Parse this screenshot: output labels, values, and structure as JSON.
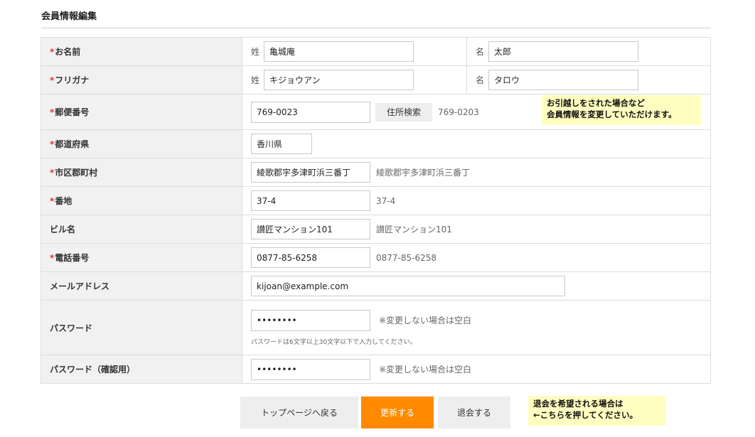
{
  "page_title": "会員情報編集",
  "required_mark": "*",
  "rows": {
    "name": {
      "label": "お名前",
      "last_prefix": "姓",
      "last_value": "亀城庵",
      "first_prefix": "名",
      "first_value": "太郎"
    },
    "kana": {
      "label": "フリガナ",
      "last_prefix": "姓",
      "last_value": "キジョウアン",
      "first_prefix": "名",
      "first_value": "タロウ"
    },
    "postal": {
      "label": "郵便番号",
      "value": "769-0023",
      "search_button": "住所検索",
      "hint": "769-0203"
    },
    "prefecture": {
      "label": "都道府県",
      "value": "香川県"
    },
    "city": {
      "label": "市区郡町村",
      "value": "綾歌郡宇多津町浜三番丁",
      "hint": "綾歌郡宇多津町浜三番丁"
    },
    "address": {
      "label": "番地",
      "value": "37-4",
      "hint": "37-4"
    },
    "building": {
      "label": "ビル名",
      "value": "讃匠マンション101",
      "hint": "讃匠マンション101"
    },
    "phone": {
      "label": "電話番号",
      "value": "0877-85-6258",
      "hint": "0877-85-6258"
    },
    "email": {
      "label": "メールアドレス",
      "value": "kijoan@example.com"
    },
    "password": {
      "label": "パスワード",
      "value": "••••••••",
      "hint": "※変更しない場合は空白",
      "note": "パスワードは6文字以上30文字以下で入力してください。"
    },
    "password_confirm": {
      "label": "パスワード（確認用）",
      "value": "••••••••",
      "hint": "※変更しない場合は空白"
    }
  },
  "tooltip_move": {
    "line1": "お引越しをされた場合など",
    "line2": "会員情報を変更していただけます。"
  },
  "buttons": {
    "back": "トップページへ戻る",
    "update": "更新する",
    "withdraw": "退会する"
  },
  "tooltip_withdraw": {
    "line1": "退会を希望される場合は",
    "line2": "←こちらを押してください。"
  },
  "colors": {
    "accent": "#ff8a00",
    "required": "#e0392b",
    "tooltip_bg": "#fffec0",
    "label_bg": "#f1f1f1"
  }
}
